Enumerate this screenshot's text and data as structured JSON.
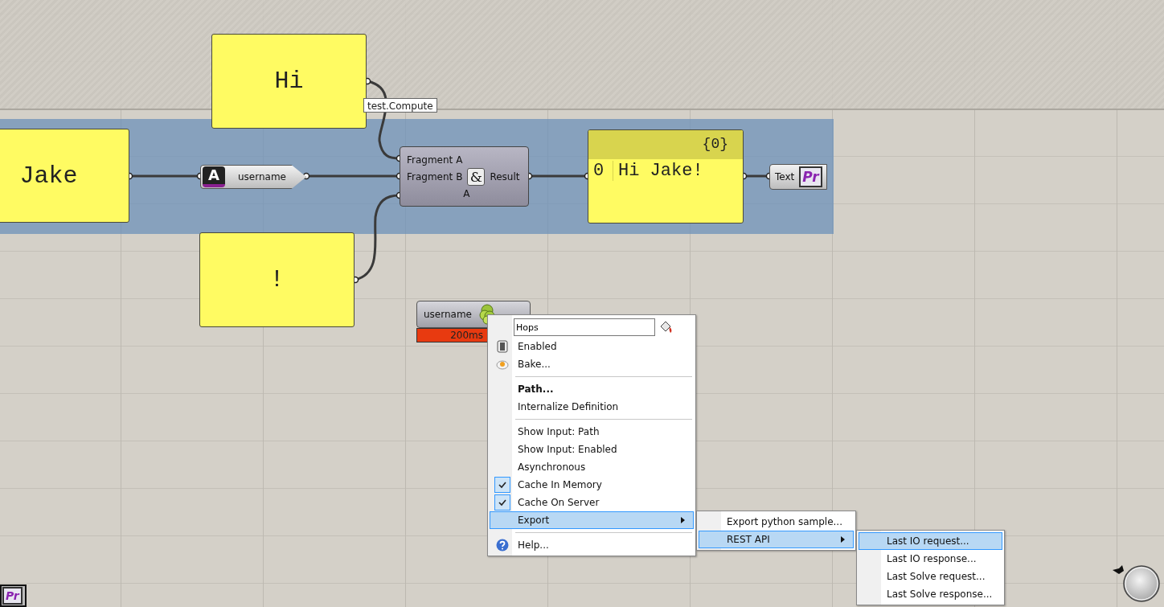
{
  "canvas": {
    "tooltip": "test.Compute",
    "panels": [
      {
        "text": "Hi"
      },
      {
        "text": "Jake"
      },
      {
        "text": "!"
      }
    ],
    "username_param": {
      "icon_text": "A",
      "label": "username"
    },
    "concatenate": {
      "inputs": [
        "Fragment A",
        "Fragment B",
        "A"
      ],
      "icon_text": "&",
      "output": "Result"
    },
    "output_panel": {
      "path": "{0}",
      "index": "0",
      "value": "Hi Jake!"
    },
    "text_param": {
      "label": "Text",
      "icon_text": "Pr"
    },
    "hops": {
      "input": "username",
      "timing": "200ms"
    },
    "corner_icon_text": "Pr"
  },
  "context_menu": {
    "items": [
      {
        "kind": "field",
        "value": "Hops"
      },
      {
        "kind": "item",
        "label": "Enabled",
        "checked": false,
        "selected": false,
        "bold": false
      },
      {
        "kind": "item",
        "label": "Bake...",
        "checked": false,
        "selected": false,
        "bold": false
      },
      {
        "kind": "separator"
      },
      {
        "kind": "item",
        "label": "Path...",
        "checked": false,
        "selected": false,
        "bold": true
      },
      {
        "kind": "item",
        "label": "Internalize Definition",
        "checked": false,
        "selected": false,
        "bold": false
      },
      {
        "kind": "separator"
      },
      {
        "kind": "item",
        "label": "Show Input: Path",
        "checked": false,
        "selected": false,
        "bold": false
      },
      {
        "kind": "item",
        "label": "Show Input: Enabled",
        "checked": false,
        "selected": false,
        "bold": false
      },
      {
        "kind": "item",
        "label": "Asynchronous",
        "checked": false,
        "selected": false,
        "bold": false
      },
      {
        "kind": "item",
        "label": "Cache In Memory",
        "checked": true,
        "selected": false,
        "bold": false
      },
      {
        "kind": "item",
        "label": "Cache On Server",
        "checked": true,
        "selected": false,
        "bold": false
      },
      {
        "kind": "submenu",
        "label": "Export",
        "checked": false,
        "selected": true,
        "bold": false
      },
      {
        "kind": "separator"
      },
      {
        "kind": "item",
        "label": "Help...",
        "checked": false,
        "selected": false,
        "bold": false
      }
    ]
  },
  "export_submenu": {
    "items": [
      {
        "kind": "item",
        "label": "Export python sample...",
        "selected": false
      },
      {
        "kind": "submenu",
        "label": "REST API",
        "selected": true
      }
    ]
  },
  "rest_api_submenu": {
    "items": [
      {
        "label": "Last IO request...",
        "selected": true
      },
      {
        "label": "Last IO response...",
        "selected": false
      },
      {
        "label": "Last Solve request...",
        "selected": false
      },
      {
        "label": "Last Solve response...",
        "selected": false
      }
    ]
  }
}
